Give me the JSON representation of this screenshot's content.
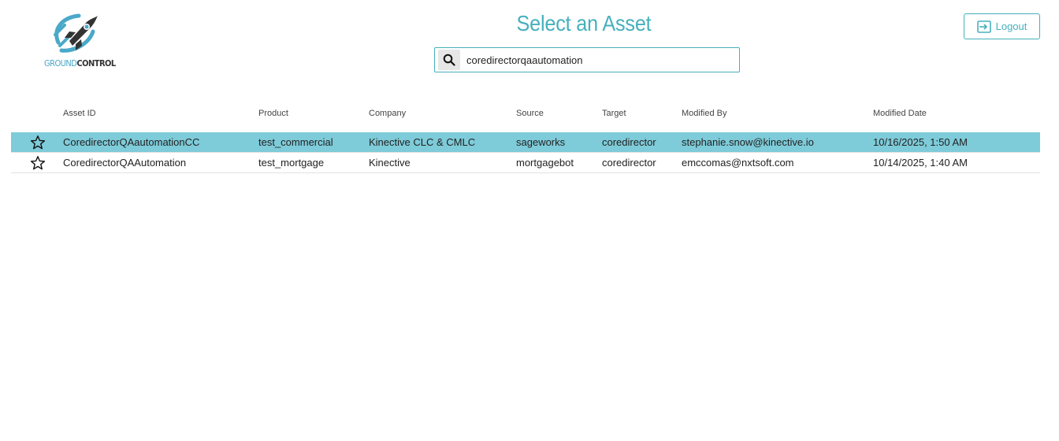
{
  "logo": {
    "part1": "GROUND",
    "part2": "CONTROL"
  },
  "title": "Select an Asset",
  "search": {
    "value": "coredirectorqaautomation",
    "placeholder": ""
  },
  "logout": {
    "label": "Logout"
  },
  "colors": {
    "accent": "#45b0bd",
    "selected_row": "#7ecbd9"
  },
  "table": {
    "headers": {
      "asset_id": "Asset ID",
      "product": "Product",
      "company": "Company",
      "source": "Source",
      "target": "Target",
      "modified_by": "Modified By",
      "modified_date": "Modified Date"
    },
    "rows": [
      {
        "selected": true,
        "favorite_icon": "star-outline-icon",
        "asset_id": "CoredirectorQAautomationCC",
        "product": "test_commercial",
        "company": "Kinective CLC & CMLC",
        "source": "sageworks",
        "target": "coredirector",
        "modified_by": "stephanie.snow@kinective.io",
        "modified_date": "10/16/2025, 1:50 AM"
      },
      {
        "selected": false,
        "favorite_icon": "star-outline-icon",
        "asset_id": "CoredirectorQAAutomation",
        "product": "test_mortgage",
        "company": "Kinective",
        "source": "mortgagebot",
        "target": "coredirector",
        "modified_by": "emccomas@nxtsoft.com",
        "modified_date": "10/14/2025, 1:40 AM"
      }
    ]
  }
}
